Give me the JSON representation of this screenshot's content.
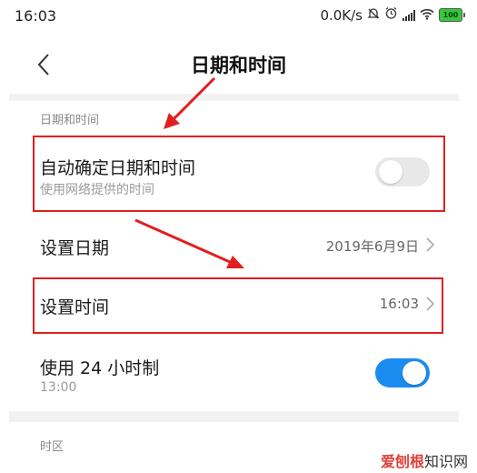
{
  "status_bar": {
    "time": "16:03",
    "net_speed": "0.0K/s",
    "battery": "100",
    "icons": [
      "mute-icon",
      "alarm-icon",
      "signal-icon",
      "wifi-icon",
      "battery-icon"
    ]
  },
  "header": {
    "title": "日期和时间",
    "back_icon": "chevron-left-icon"
  },
  "sections": {
    "date_time_label": "日期和时间",
    "timezone_label": "时区"
  },
  "rows": {
    "auto_datetime": {
      "title": "自动确定日期和时间",
      "subtitle": "使用网络提供的时间",
      "toggle": "off"
    },
    "set_date": {
      "title": "设置日期",
      "value": "2019年6月9日"
    },
    "set_time": {
      "title": "设置时间",
      "value": "16:03"
    },
    "use_24h": {
      "title": "使用 24 小时制",
      "subtitle": "13:00",
      "toggle": "on"
    }
  },
  "annotations": {
    "highlight_color": "#e02020"
  },
  "colors": {
    "accent": "#1a8cf0",
    "toggle_off": "#e8e8e8"
  },
  "watermark": {
    "brand": "爱刨根",
    "suffix": "知识网"
  }
}
